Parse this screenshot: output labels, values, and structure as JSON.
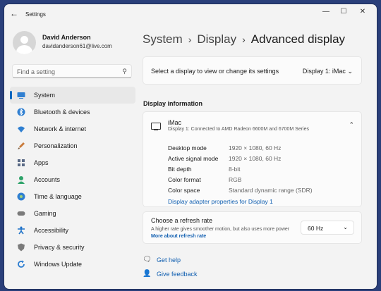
{
  "window": {
    "title": "Settings"
  },
  "user": {
    "name": "David Anderson",
    "email": "davidanderson61@live.com"
  },
  "search": {
    "placeholder": "Find a setting"
  },
  "nav": [
    {
      "label": "System",
      "icon": "system-icon",
      "color": "#2f7fd1"
    },
    {
      "label": "Bluetooth & devices",
      "icon": "bluetooth-icon",
      "color": "#2f7fd1"
    },
    {
      "label": "Network & internet",
      "icon": "wifi-icon",
      "color": "#2f7fd1"
    },
    {
      "label": "Personalization",
      "icon": "brush-icon",
      "color": "#c97a3a"
    },
    {
      "label": "Apps",
      "icon": "apps-icon",
      "color": "#5a6a86"
    },
    {
      "label": "Accounts",
      "icon": "accounts-icon",
      "color": "#2fa36a"
    },
    {
      "label": "Time & language",
      "icon": "globe-icon",
      "color": "#2f7fd1"
    },
    {
      "label": "Gaming",
      "icon": "gaming-icon",
      "color": "#7a7a7a"
    },
    {
      "label": "Accessibility",
      "icon": "accessibility-icon",
      "color": "#1a6fc7"
    },
    {
      "label": "Privacy & security",
      "icon": "shield-icon",
      "color": "#7a7a7a"
    },
    {
      "label": "Windows Update",
      "icon": "update-icon",
      "color": "#2f7fd1"
    }
  ],
  "breadcrumb": {
    "part1": "System",
    "part2": "Display",
    "current": "Advanced display"
  },
  "display_select": {
    "label": "Select a display to view or change its settings",
    "value": "Display 1: iMac"
  },
  "display_info": {
    "section_title": "Display information",
    "name": "iMac",
    "subtitle": "Display 1: Connected to AMD Radeon 6600M and 6700M Series",
    "rows": [
      {
        "label": "Desktop mode",
        "value": "1920 × 1080, 60 Hz"
      },
      {
        "label": "Active signal mode",
        "value": "1920 × 1080, 60 Hz"
      },
      {
        "label": "Bit depth",
        "value": "8-bit"
      },
      {
        "label": "Color format",
        "value": "RGB"
      },
      {
        "label": "Color space",
        "value": "Standard dynamic range (SDR)"
      }
    ],
    "adapter_link": "Display adapter properties for Display 1"
  },
  "refresh": {
    "title": "Choose a refresh rate",
    "desc": "A higher rate gives smoother motion, but also uses more power",
    "more_link": "More about refresh rate",
    "value": "60 Hz"
  },
  "help": {
    "get_help": "Get help",
    "give_feedback": "Give feedback"
  },
  "colors": {
    "accent": "#0067c0",
    "link": "#0f5eb0"
  }
}
